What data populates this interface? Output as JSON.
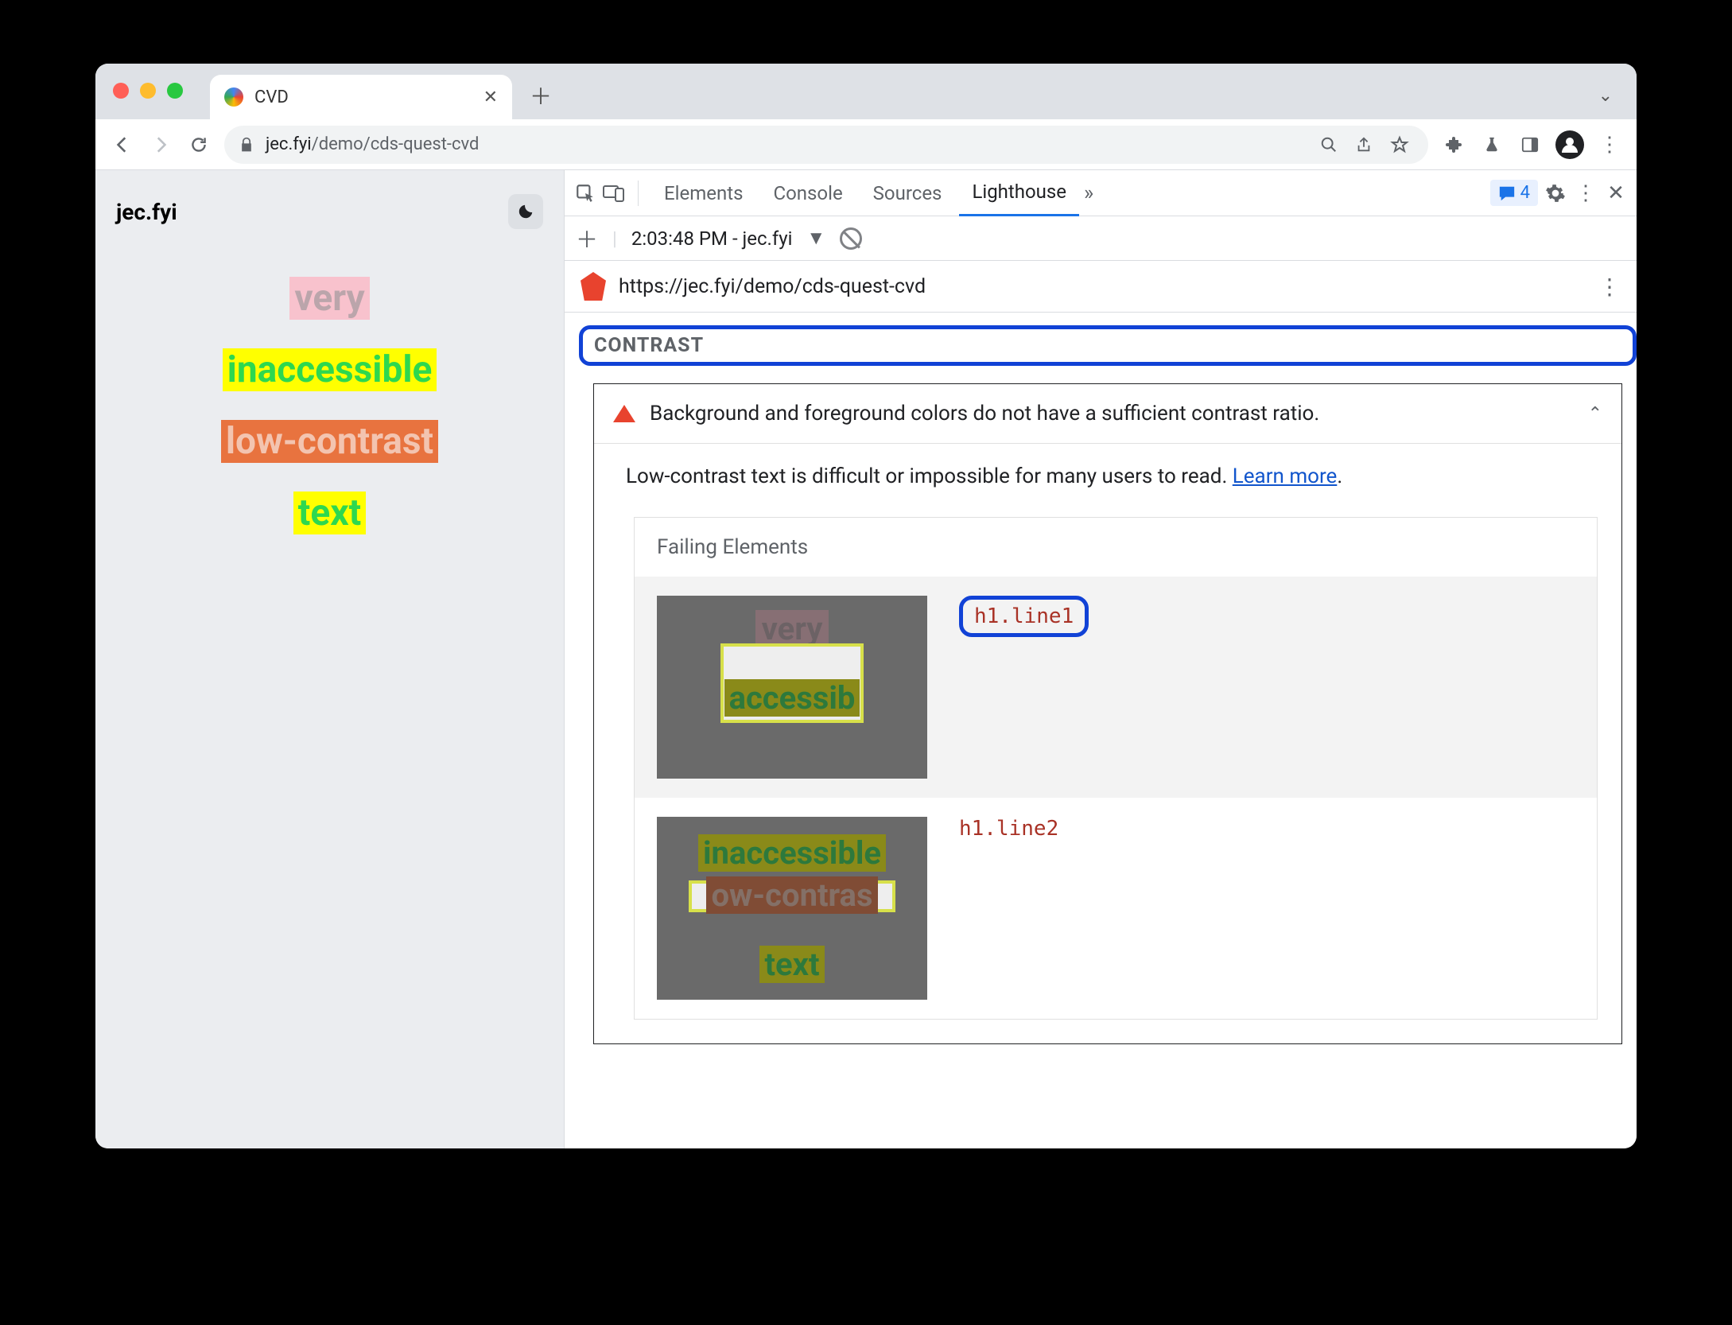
{
  "browser": {
    "tab_title": "CVD",
    "url_domain": "jec.fyi",
    "url_path": "/demo/cds-quest-cvd"
  },
  "page": {
    "site_title": "jec.fyi",
    "lines": {
      "l1": "very",
      "l2": "inaccessible",
      "l3": "low-contrast",
      "l4": "text"
    }
  },
  "devtools": {
    "tabs": {
      "elements": "Elements",
      "console": "Console",
      "sources": "Sources",
      "lighthouse": "Lighthouse"
    },
    "issues_count": "4",
    "report_select": "2:03:48 PM - jec.fyi",
    "report_url": "https://jec.fyi/demo/cds-quest-cvd",
    "section": "CONTRAST",
    "audit": {
      "title": "Background and foreground colors do not have a sufficient contrast ratio.",
      "desc_pre": "Low-contrast text is difficult or impossible for many users to read. ",
      "learn": "Learn more",
      "desc_post": ".",
      "failing_header": "Failing Elements",
      "items": {
        "i1": "h1.line1",
        "i2": "h1.line2"
      },
      "thumb1": {
        "g1": "very",
        "g2": "accessib"
      },
      "thumb2": {
        "g1": "inaccessible",
        "g2": "ow-contras",
        "g3": "text"
      }
    }
  }
}
